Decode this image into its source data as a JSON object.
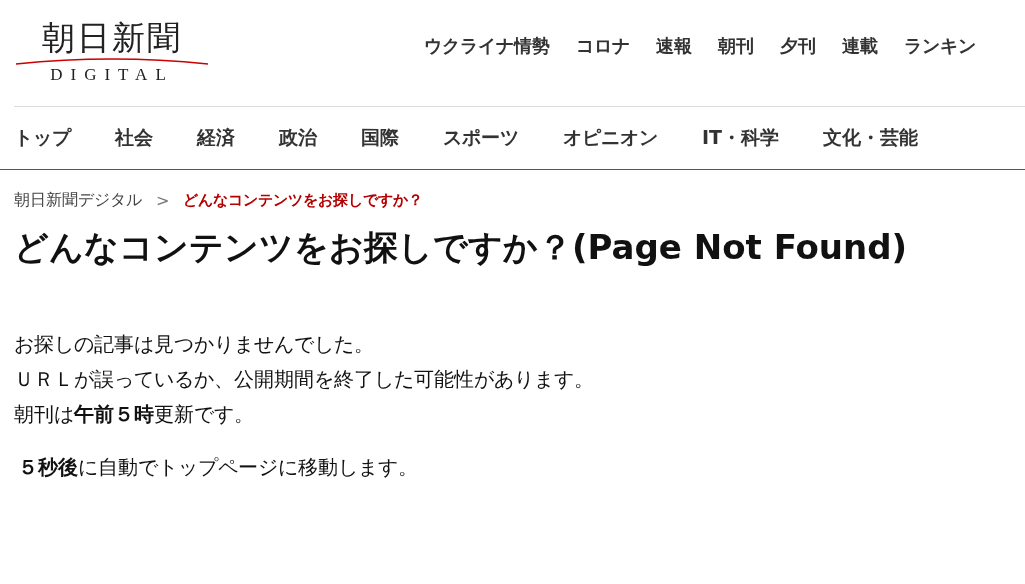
{
  "logo": {
    "title": "朝日新聞",
    "subtitle": "DIGITAL"
  },
  "top_nav": [
    "ウクライナ情勢",
    "コロナ",
    "速報",
    "朝刊",
    "夕刊",
    "連載",
    "ランキン"
  ],
  "category_nav": [
    "トップ",
    "社会",
    "経済",
    "政治",
    "国際",
    "スポーツ",
    "オピニオン",
    "IT・科学",
    "文化・芸能"
  ],
  "breadcrumb": [
    {
      "label": "朝日新聞デジタル",
      "selected": false
    },
    {
      "label": "どんなコンテンツをお探しですか？",
      "selected": true
    }
  ],
  "breadcrumb_separator": ">",
  "heading": "どんなコンテンツをお探しですか？(Page Not Found)",
  "paragraphs": [
    "お探しの記事は見つかりませんでした。",
    "ＵＲＬが誤っているか、公開期間を終了した可能性があります。",
    "朝刊は**午前５時**更新です。"
  ],
  "redirect_note": "**５秒後**に自動でトップページに移動します。"
}
